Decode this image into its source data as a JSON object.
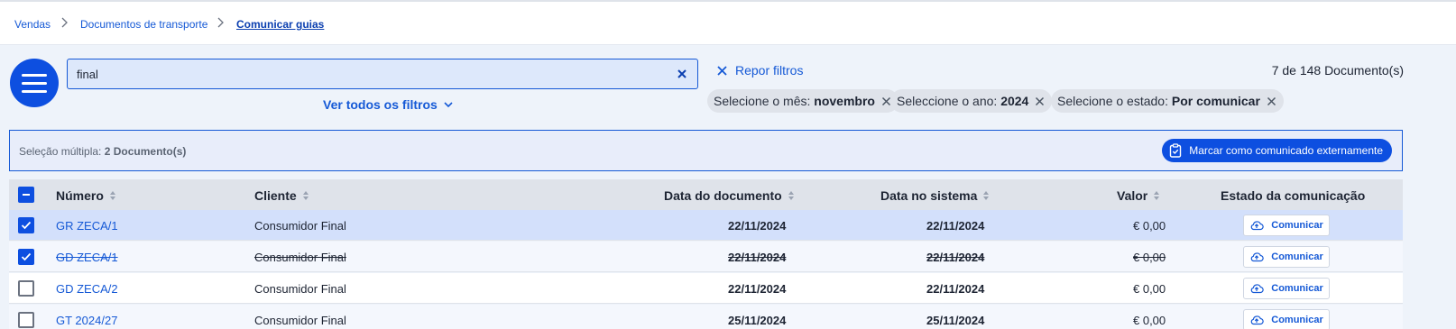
{
  "breadcrumb": {
    "items": [
      "Vendas",
      "Documentos de transporte",
      "Comunicar guias"
    ]
  },
  "search": {
    "value": "final",
    "placeholder": ""
  },
  "filters": {
    "toggle_label": "Ver todos os filtros",
    "reset_label": "Repor filtros",
    "count": "7 de 148 Documento(s)",
    "chips": [
      {
        "label": "Selecione o mês:",
        "value": "novembro"
      },
      {
        "label": "Seleccione o ano:",
        "value": "2024"
      },
      {
        "label": "Selecione o estado:",
        "value": "Por comunicar"
      }
    ]
  },
  "selection": {
    "label": "Seleção múltipla:",
    "value": "2 Documento(s)",
    "action_label": "Marcar como comunicado externamente"
  },
  "table": {
    "columns": {
      "numero": "Número",
      "cliente": "Cliente",
      "data_doc": "Data do documento",
      "data_sis": "Data no sistema",
      "valor": "Valor",
      "estado": "Estado da comunicação"
    },
    "rows": [
      {
        "numero": "GR ZECA/1",
        "cliente": "Consumidor Final",
        "data_doc": "22/11/2024",
        "data_sis": "22/11/2024",
        "valor": "€ 0,00",
        "action": "Comunicar",
        "checked": true,
        "struck": false
      },
      {
        "numero": "GD ZECA/1",
        "cliente": "Consumidor Final",
        "data_doc": "22/11/2024",
        "data_sis": "22/11/2024",
        "valor": "€ 0,00",
        "action": "Comunicar",
        "checked": true,
        "struck": true
      },
      {
        "numero": "GD ZECA/2",
        "cliente": "Consumidor Final",
        "data_doc": "22/11/2024",
        "data_sis": "22/11/2024",
        "valor": "€ 0,00",
        "action": "Comunicar",
        "checked": false,
        "struck": false
      },
      {
        "numero": "GT 2024/27",
        "cliente": "Consumidor Final",
        "data_doc": "25/11/2024",
        "data_sis": "25/11/2024",
        "valor": "€ 0,00",
        "action": "Comunicar",
        "checked": false,
        "struck": false
      }
    ]
  },
  "colors": {
    "accent": "#0d4fe0",
    "link": "#1559d6",
    "selected_row": "#d3e0fb",
    "row_alt": "#f4f7fd",
    "row": "#ffffff"
  }
}
